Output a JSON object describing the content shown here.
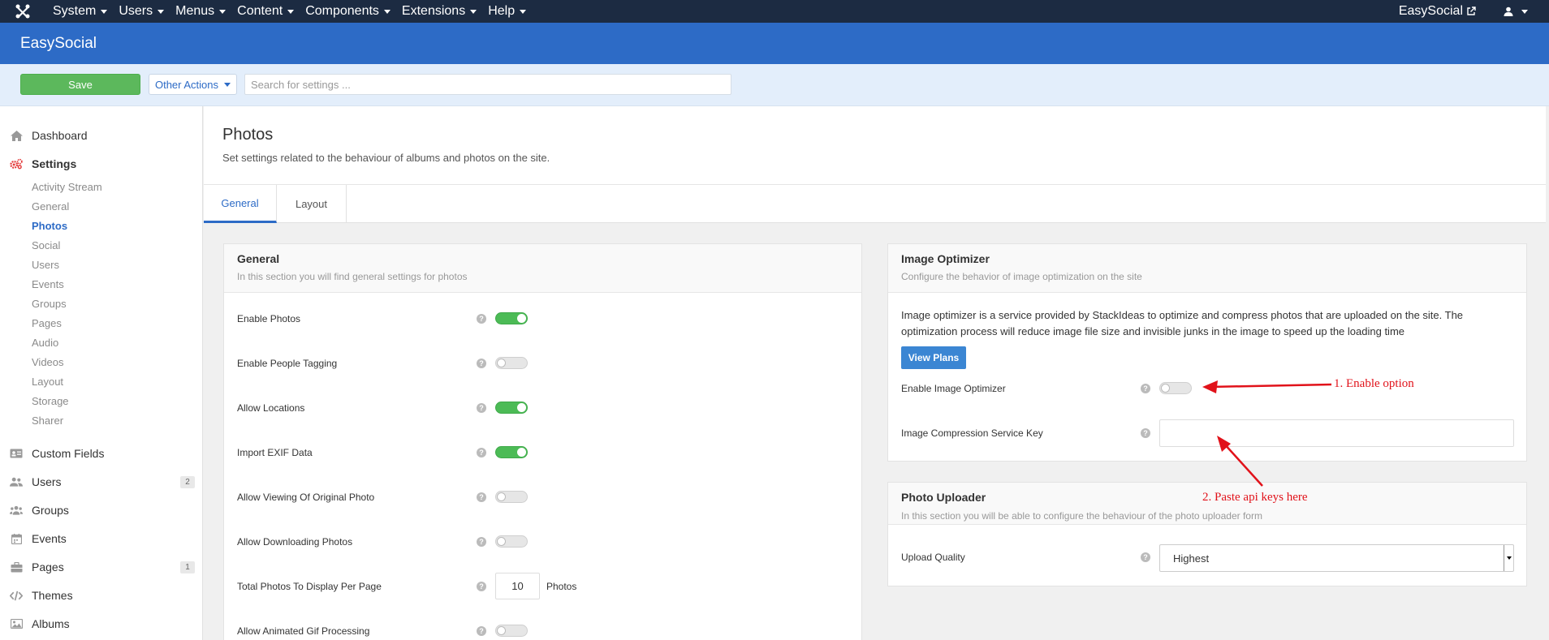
{
  "topbar": {
    "menus": [
      {
        "label": "System"
      },
      {
        "label": "Users"
      },
      {
        "label": "Menus"
      },
      {
        "label": "Content"
      },
      {
        "label": "Components"
      },
      {
        "label": "Extensions"
      },
      {
        "label": "Help"
      }
    ],
    "site_label": "EasySocial"
  },
  "header": {
    "title": "EasySocial"
  },
  "toolbar": {
    "save_label": "Save",
    "other_actions_label": "Other Actions",
    "search_placeholder": "Search for settings ..."
  },
  "sidebar": {
    "dashboard": "Dashboard",
    "settings": "Settings",
    "sub_items": [
      "Activity Stream",
      "General",
      "Photos",
      "Social",
      "Users",
      "Events",
      "Groups",
      "Pages",
      "Audio",
      "Videos",
      "Layout",
      "Storage",
      "Sharer"
    ],
    "active_sub": "Photos",
    "custom_fields": "Custom Fields",
    "users": "Users",
    "users_count": "2",
    "groups": "Groups",
    "events": "Events",
    "pages": "Pages",
    "pages_count": "1",
    "themes": "Themes",
    "albums": "Albums"
  },
  "page": {
    "title": "Photos",
    "description": "Set settings related to the behaviour of albums and photos on the site."
  },
  "tabs": [
    {
      "label": "General",
      "active": true
    },
    {
      "label": "Layout",
      "active": false
    }
  ],
  "general_panel": {
    "title": "General",
    "subtitle": "In this section you will find general settings for photos",
    "rows": [
      {
        "label": "Enable Photos",
        "type": "toggle",
        "on": true
      },
      {
        "label": "Enable People Tagging",
        "type": "toggle",
        "on": false
      },
      {
        "label": "Allow Locations",
        "type": "toggle",
        "on": true
      },
      {
        "label": "Import EXIF Data",
        "type": "toggle",
        "on": true
      },
      {
        "label": "Allow Viewing Of Original Photo",
        "type": "toggle",
        "on": false
      },
      {
        "label": "Allow Downloading Photos",
        "type": "toggle",
        "on": false
      },
      {
        "label": "Total Photos To Display Per Page",
        "type": "number",
        "value": "10",
        "unit": "Photos"
      },
      {
        "label": "Allow Animated Gif Processing",
        "type": "toggle",
        "on": false
      }
    ]
  },
  "optimizer_panel": {
    "title": "Image Optimizer",
    "subtitle": "Configure the behavior of image optimization on the site",
    "description": "Image optimizer is a service provided by StackIdeas to optimize and compress photos that are uploaded on the site. The optimization process will reduce image file size and invisible junks in the image to speed up the loading time",
    "view_plans_label": "View Plans",
    "enable_label": "Enable Image Optimizer",
    "enable_on": false,
    "key_label": "Image Compression Service Key",
    "key_value": ""
  },
  "uploader_panel": {
    "title": "Photo Uploader",
    "subtitle": "In this section you will be able to configure the behaviour of the photo uploader form",
    "quality_label": "Upload Quality",
    "quality_value": "Highest"
  },
  "annotations": {
    "step1": "1. Enable option",
    "step2": "2. Paste api keys here"
  },
  "colors": {
    "topbar": "#1c2b42",
    "header": "#2d6bc6",
    "toggle_on": "#4cbb56",
    "annotation": "#e1121a"
  }
}
